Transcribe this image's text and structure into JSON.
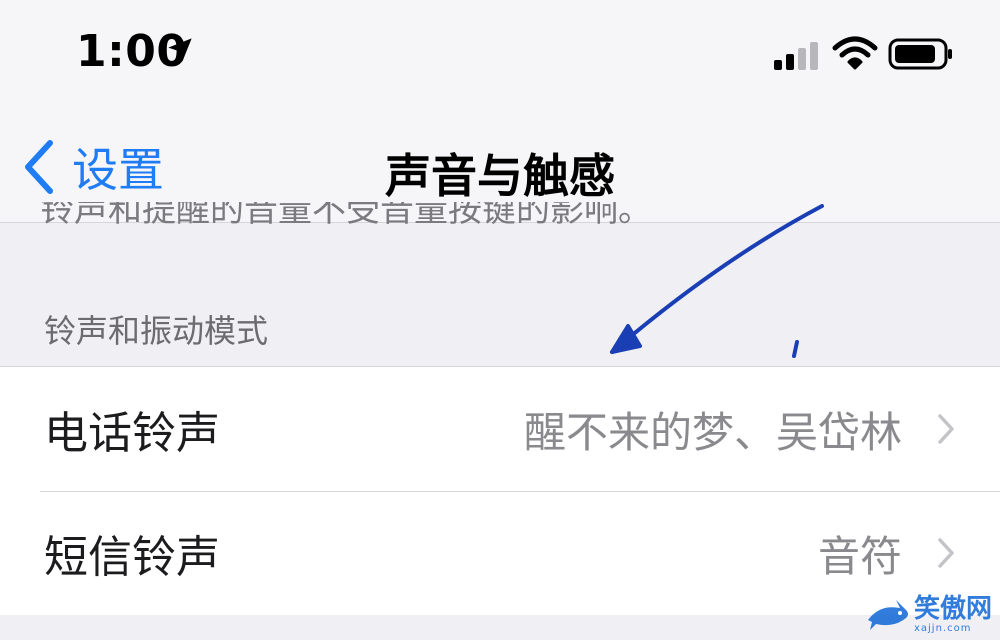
{
  "status_bar": {
    "time": "1:00",
    "icons": [
      "location-arrow-icon",
      "cellular-signal-icon",
      "wifi-icon",
      "battery-icon"
    ]
  },
  "nav": {
    "back_label": "设置",
    "title": "声音与触感"
  },
  "scrolled_text": "铃声和提醒的音量不受音量按键的影响。",
  "section": {
    "header": "铃声和振动模式",
    "items": [
      {
        "label": "电话铃声",
        "value": "醒不来的梦、吴岱林"
      },
      {
        "label": "短信铃声",
        "value": "音符"
      }
    ]
  },
  "watermark": {
    "text": "笑傲网",
    "url": "xajjn.com"
  },
  "colors": {
    "accent": "#1f7cf5",
    "background": "#efeff4",
    "annotation": "#1a3fb5"
  }
}
